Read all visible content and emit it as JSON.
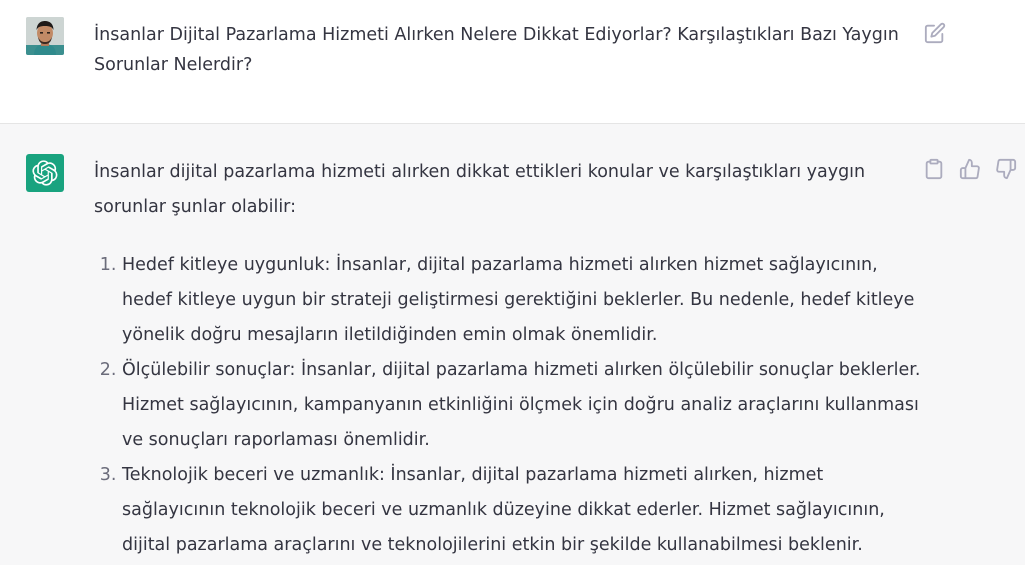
{
  "user_message": {
    "text": "İnsanlar Dijital Pazarlama Hizmeti Alırken Nelere Dikkat Ediyorlar? Karşılaştıkları Bazı Yaygın Sorunlar Nelerdir?"
  },
  "assistant_message": {
    "intro": "İnsanlar dijital pazarlama hizmeti alırken dikkat ettikleri konular ve karşılaştıkları yaygın sorunlar şunlar olabilir:",
    "items": [
      "Hedef kitleye uygunluk: İnsanlar, dijital pazarlama hizmeti alırken hizmet sağlayıcının, hedef kitleye uygun bir strateji geliştirmesi gerektiğini beklerler. Bu nedenle, hedef kitleye yönelik doğru mesajların iletildiğinden emin olmak önemlidir.",
      "Ölçülebilir sonuçlar: İnsanlar, dijital pazarlama hizmeti alırken ölçülebilir sonuçlar beklerler. Hizmet sağlayıcının, kampanyanın etkinliğini ölçmek için doğru analiz araçlarını kullanması ve sonuçları raporlaması önemlidir.",
      "Teknolojik beceri ve uzmanlık: İnsanlar, dijital pazarlama hizmeti alırken, hizmet sağlayıcının teknolojik beceri ve uzmanlık düzeyine dikkat ederler. Hizmet sağlayıcının, dijital pazarlama araçlarını ve teknolojilerini etkin bir şekilde kullanabilmesi beklenir."
    ]
  },
  "icons": {
    "edit": "edit-icon",
    "copy": "clipboard-icon",
    "like": "thumbs-up-icon",
    "dislike": "thumbs-down-icon",
    "assistant_logo": "openai-logo-icon"
  },
  "colors": {
    "assistant_avatar": "#19a37f",
    "assistant_bg": "#f7f7f8",
    "user_bg": "#ffffff",
    "text": "#343541",
    "icon": "#acacbe"
  }
}
